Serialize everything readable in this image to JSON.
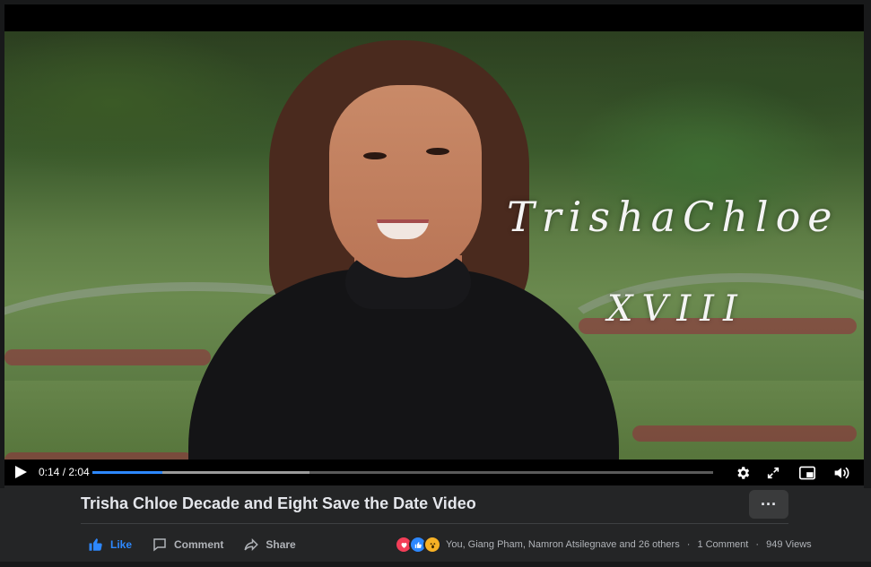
{
  "player": {
    "overlay_title": "TrishaChloe",
    "overlay_subtitle": "XVIII",
    "current_time": "0:14",
    "duration": "2:04",
    "time_display": "0:14 / 2:04",
    "played_fraction": 0.113,
    "buffered_fraction": 0.35,
    "controls": {
      "play_icon": "play-icon",
      "settings_icon": "gear-icon",
      "fullscreen_icon": "expand-icon",
      "pip_icon": "picture-in-picture-icon",
      "volume_icon": "volume-icon"
    }
  },
  "post": {
    "title": "Trisha Chloe Decade and Eight Save the Date Video",
    "more_label": "···",
    "actions": {
      "like": "Like",
      "comment": "Comment",
      "share": "Share"
    },
    "reactions_summary": "You, Giang Pham, Namron Atsilegnave and 26 others",
    "comments_count": "1 Comment",
    "views_count": "949 Views",
    "separator": "·"
  },
  "colors": {
    "accent": "#2d88ff",
    "background": "#242526",
    "text": "#e4e6eb",
    "muted": "#b0b3b8"
  }
}
